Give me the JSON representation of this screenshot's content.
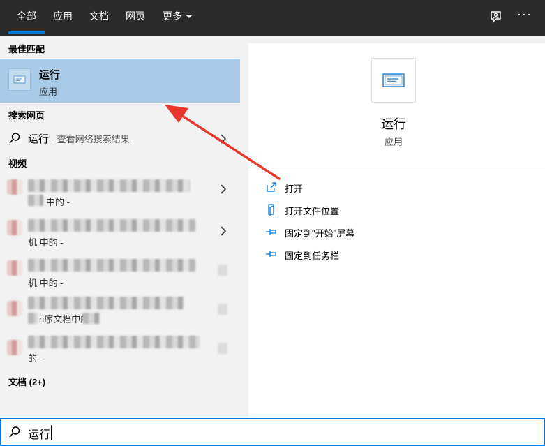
{
  "tabs": [
    {
      "label": "全部",
      "active": true
    },
    {
      "label": "应用"
    },
    {
      "label": "文档"
    },
    {
      "label": "网页"
    },
    {
      "label": "更多"
    }
  ],
  "top_icons": [
    "feedback-icon",
    "more-options-icon"
  ],
  "more_icon_text": "···",
  "sections": {
    "best_match": "最佳匹配",
    "web_search": "搜索网页",
    "videos": "视频",
    "documents": "文档 (2+)"
  },
  "best_match_item": {
    "title": "运行",
    "subtitle": "应用"
  },
  "web_result": {
    "query": "运行",
    "hint": " - 查看网络搜索结果"
  },
  "video_items": [
    {
      "line2": "中的 -",
      "has_chevron": true
    },
    {
      "line2": "机 中的 -",
      "has_chevron": true
    },
    {
      "line2": "机 中的 -",
      "has_chevron": false
    },
    {
      "line2": "n序文档中的",
      "has_chevron": false
    },
    {
      "line2": "的 -",
      "has_chevron": false
    }
  ],
  "preview": {
    "title": "运行",
    "subtitle": "应用"
  },
  "actions": [
    {
      "label": "打开",
      "icon": "open-icon"
    },
    {
      "label": "打开文件位置",
      "icon": "file-location-icon"
    },
    {
      "label": "固定到\"开始\"屏幕",
      "icon": "pin-icon"
    },
    {
      "label": "固定到任务栏",
      "icon": "pin-icon"
    }
  ],
  "search": {
    "value": "运行"
  },
  "colors": {
    "accent": "#0078d7",
    "selected": "#a9cbe8",
    "annotation": "#e8382e"
  }
}
